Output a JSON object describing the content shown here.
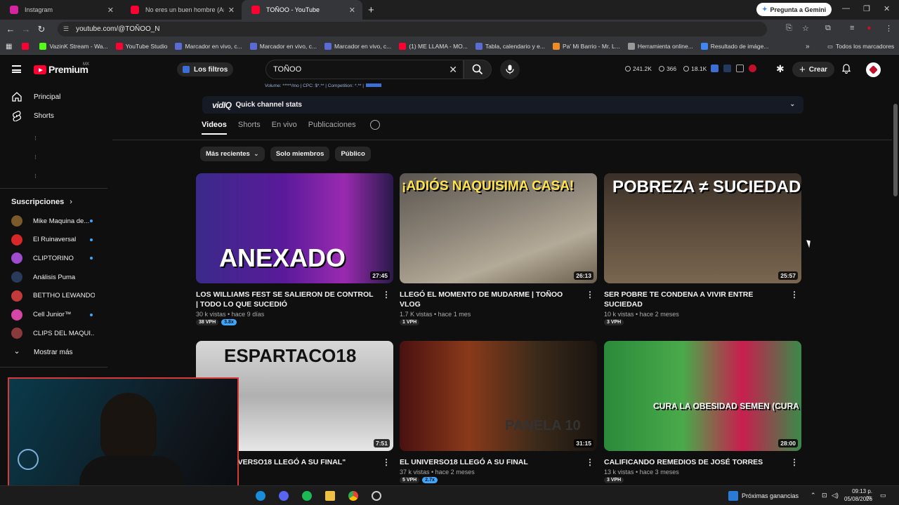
{
  "browser": {
    "tabs": [
      {
        "title": "Instagram",
        "color": "#d6249f"
      },
      {
        "title": "No eres un buen hombre (Anál",
        "color": "#ff0033"
      },
      {
        "title": "TOÑOO - YouTube",
        "color": "#ff0033"
      }
    ],
    "new_tab": "+",
    "gemini_label": "Pregunta a Gemini",
    "url": "youtube.com/@TOÑOO_N",
    "bookmarks": [
      {
        "label": "",
        "color": "#ff0033"
      },
      {
        "label": "VazinK Stream - Wa...",
        "color": "#53fc18"
      },
      {
        "label": "YouTube Studio",
        "color": "#ff0033"
      },
      {
        "label": "Marcador en vivo, c...",
        "color": "#5b6bd6"
      },
      {
        "label": "Marcador en vivo, c...",
        "color": "#5b6bd6"
      },
      {
        "label": "Marcador en vivo, c...",
        "color": "#5b6bd6"
      },
      {
        "label": "(1) ME LLAMA - MO...",
        "color": "#ff0033"
      },
      {
        "label": "Tabla, calendario y e...",
        "color": "#5b6bd6"
      },
      {
        "label": "Pa' Mi Barrio - Mr. L...",
        "color": "#f08a24"
      },
      {
        "label": "Herramienta online...",
        "color": "#999999"
      },
      {
        "label": "Resultado de imáge...",
        "color": "#4285f4"
      }
    ],
    "all_bookmarks": "Todos los marcadores"
  },
  "masthead": {
    "brand": "Premium",
    "region": "MX",
    "filters_label": "Los filtros",
    "search_value": "TOÑOO",
    "stats": [
      "241.2K",
      "366",
      "18.1K"
    ],
    "create_label": "Crear",
    "vidiq_line": "Volume: *****/mo | CPC: $*.** | Competition: *.** |"
  },
  "sidebar": {
    "items": [
      {
        "label": "Principal"
      },
      {
        "label": "Shorts"
      }
    ],
    "subs_title": "Suscripciones",
    "subscriptions": [
      {
        "name": "Mike Maquina de...",
        "color": "#7a5a2a"
      },
      {
        "name": "El Ruinaversal",
        "color": "#d62828"
      },
      {
        "name": "CLIPTORINO",
        "color": "#a04ccf"
      },
      {
        "name": "Análisis Puma",
        "color": "#2a3a5a"
      },
      {
        "name": "BETTHO LEWANDO...",
        "color": "#c23a3a"
      },
      {
        "name": "Cell Junior™",
        "color": "#d646a6"
      },
      {
        "name": "CLIPS DEL MAQUI...",
        "color": "#8a3a3a"
      }
    ],
    "show_more": "Mostrar más"
  },
  "channel": {
    "vidiq_title": "Quick channel stats",
    "vidiq_logo": "vidIQ",
    "tabs": [
      "Videos",
      "Shorts",
      "En vivo",
      "Publicaciones"
    ],
    "chips": [
      "Más recientes",
      "Solo miembros",
      "Público"
    ]
  },
  "videos": [
    {
      "title": "LOS WILLIAMS FEST SE SALIERON  DE CONTROL | TODO LO QUE SUCEDIÓ",
      "meta": "30 k vistas • hace 9 días",
      "duration": "27:45",
      "vph": "38 VPH",
      "mult": "3.8x",
      "overlay": "ANEXADO",
      "bg": "linear-gradient(90deg,#3a2a8a 0%,#5a1a9a 45%,#9a2ab0 75%,#2a1a4a 100%)"
    },
    {
      "title": "LLEGÓ EL MOMENTO DE MUDARME | TOÑOO VLOG",
      "meta": "1.7 K vistas • hace 1 mes",
      "duration": "26:13",
      "vph": "1 VPH",
      "mult": "",
      "overlay": "¡ADIÓS NAQUISIMA CASA!",
      "bg": "linear-gradient(160deg,#5a5650 0%,#8a8276 40%,#b4aa98 70%,#6a5e4c 100%)"
    },
    {
      "title": "SER POBRE TE CONDENA A VIVIR ENTRE SUCIEDAD",
      "meta": "10 k vistas • hace 2 meses",
      "duration": "25:57",
      "vph": "3 VPH",
      "mult": "",
      "overlay": "POBREZA ≠ SUCIEDAD",
      "bg": "linear-gradient(180deg,#3a3028 0%,#5a4a3a 45%,#7a6650 100%)"
    },
    {
      "title": "…E \"EL UNIVERSO18 LLEGÓ A SU FINAL\"",
      "meta": "",
      "duration": "7:51",
      "vph": "",
      "mult": "",
      "overlay": "ESPARTACO18",
      "bg": "linear-gradient(180deg,#d8d8d8 0%,#b0b0b0 50%,#e6e6e6 100%)"
    },
    {
      "title": "EL UNIVERSO18 LLEGÓ A SU FINAL",
      "meta": "37 k vistas • hace 2 meses",
      "duration": "31:15",
      "vph": "5 VPH",
      "mult": "2.7x",
      "overlay": "PANELA 10",
      "bg": "linear-gradient(90deg,#4a1010 0%,#8a3a1a 35%,#3a2a1a 70%,#1a1410 100%)"
    },
    {
      "title": "CALIFICANDO REMEDIOS DE JOSÉ TORRES",
      "meta": "13 k vistas • hace 3 meses",
      "duration": "28:00",
      "vph": "3 VPH",
      "mult": "",
      "overlay": "CURA LA OBESIDAD   SEMEN (CURA EL ACNE)",
      "bg": "linear-gradient(90deg,#2a8a3a 0%,#4aaa4a 40%,#c81e4e 70%,#3a8a4a 100%)"
    }
  ],
  "taskbar": {
    "widget": "Próximas ganancias",
    "time": "09:13 p. m.",
    "date": "05/08/2026"
  }
}
